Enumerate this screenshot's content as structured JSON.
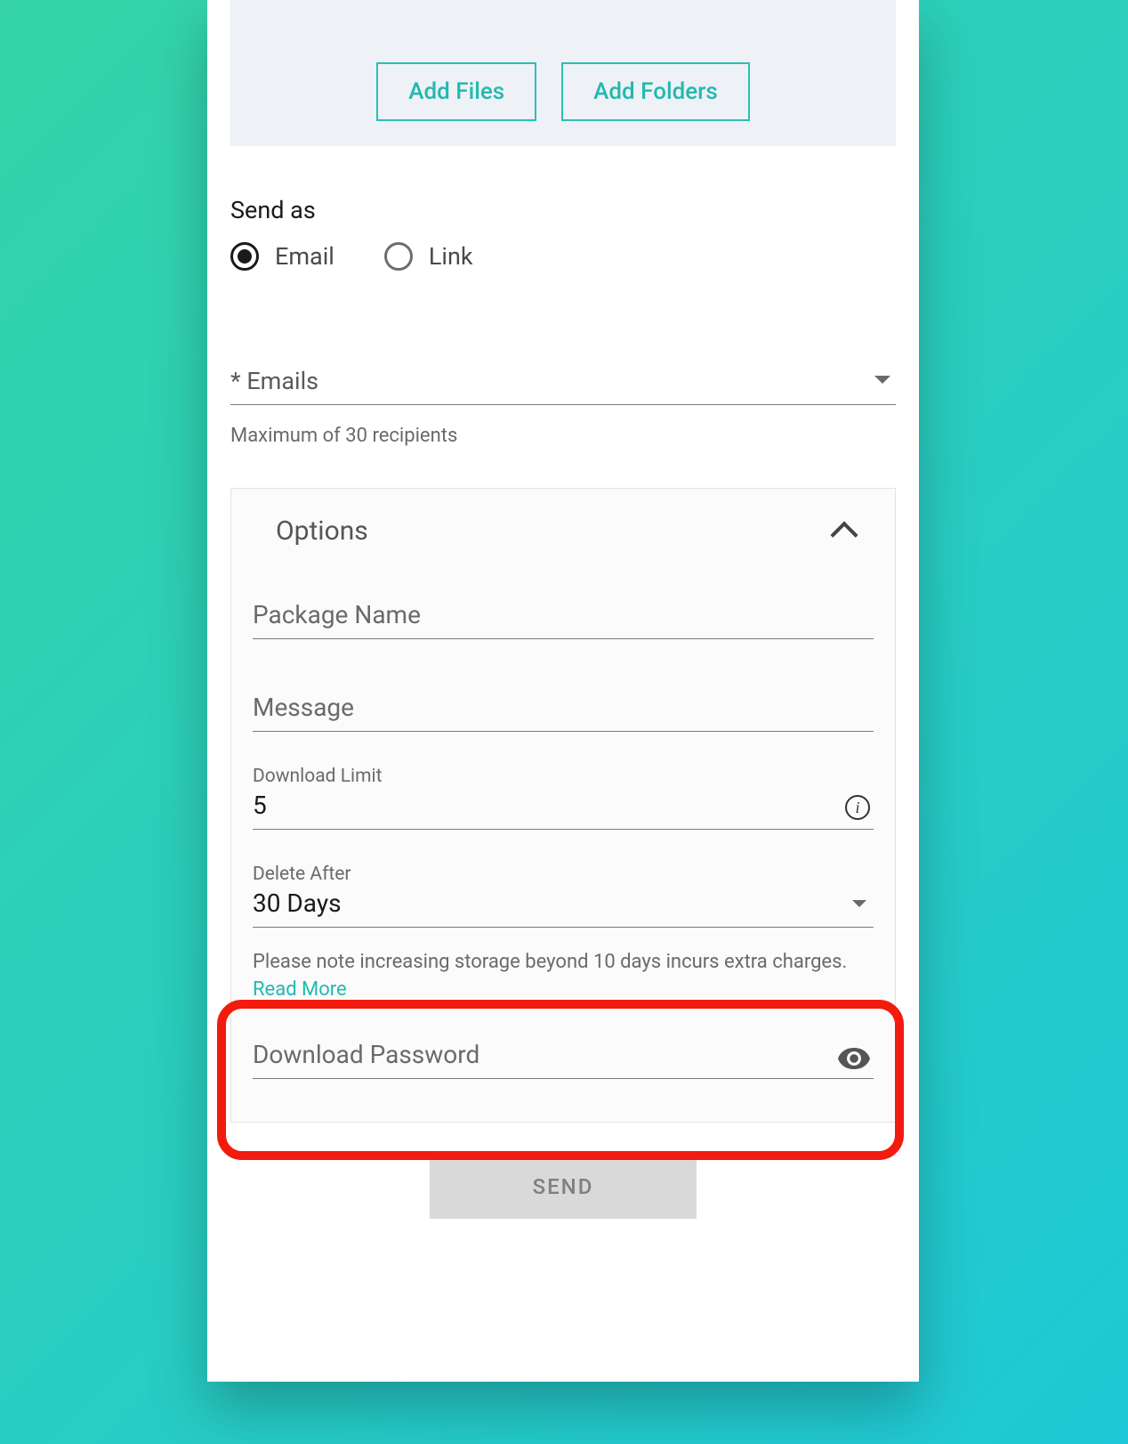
{
  "dropzone": {
    "add_files_label": "Add Files",
    "add_folders_label": "Add Folders"
  },
  "send_as": {
    "label": "Send as",
    "options": {
      "email": "Email",
      "link": "Link"
    },
    "selected": "email"
  },
  "emails": {
    "placeholder": "* Emails",
    "help": "Maximum of 30 recipients"
  },
  "options": {
    "title": "Options",
    "package_name": {
      "placeholder": "Package Name",
      "value": ""
    },
    "message": {
      "placeholder": "Message",
      "value": ""
    },
    "download_limit": {
      "label": "Download Limit",
      "value": "5"
    },
    "delete_after": {
      "label": "Delete After",
      "value": "30 Days",
      "note_prefix": "Please note increasing storage beyond 10 days incurs extra charges. ",
      "note_link": "Read More"
    },
    "download_password": {
      "placeholder": "Download Password",
      "value": ""
    }
  },
  "send_button": {
    "label": "SEND"
  }
}
